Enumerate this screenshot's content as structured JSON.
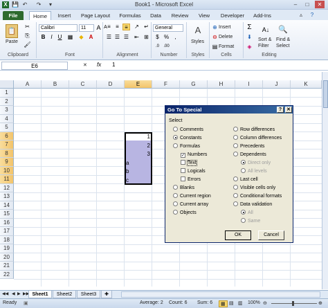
{
  "window": {
    "title": "Book1 - Microsoft Excel",
    "min": "–",
    "max": "□",
    "close": "✕"
  },
  "qat": {
    "save_icon": "💾",
    "undo_icon": "↶",
    "redo_icon": "↷"
  },
  "tabs": {
    "file": "File",
    "items": [
      "Home",
      "Insert",
      "Page Layout",
      "Formulas",
      "Data",
      "Review",
      "View",
      "Developer",
      "Add-Ins"
    ]
  },
  "ribbon": {
    "clipboard": {
      "paste": "Paste",
      "label": "Clipboard"
    },
    "font": {
      "name": "Calibri",
      "size": "11",
      "bold": "B",
      "italic": "I",
      "underline": "U",
      "label": "Font",
      "grow": "A",
      "shrink": "A"
    },
    "alignment": {
      "label": "Alignment"
    },
    "number": {
      "format": "General",
      "currency": "$",
      "percent": "%",
      "comma": ",",
      "label": "Number"
    },
    "styles": {
      "label": "Styles"
    },
    "cells": {
      "insert": "Insert",
      "delete": "Delete",
      "format": "Format",
      "label": "Cells"
    },
    "editing": {
      "sum": "Σ",
      "sort": "Sort &",
      "sort2": "Filter",
      "find": "Find &",
      "find2": "Select",
      "label": "Editing"
    }
  },
  "formula_bar": {
    "name_box": "E6",
    "fx": "fx",
    "value": "1"
  },
  "columns": [
    "A",
    "B",
    "C",
    "D",
    "E",
    "F",
    "G",
    "H",
    "I",
    "J",
    "K"
  ],
  "rows": [
    "1",
    "2",
    "3",
    "4",
    "5",
    "6",
    "7",
    "8",
    "9",
    "10",
    "11",
    "12",
    "13",
    "14",
    "15",
    "16",
    "17",
    "18",
    "19",
    "20",
    "21",
    "22"
  ],
  "cells": {
    "e6": "1",
    "e7": "2",
    "e8": "3",
    "e9": "a",
    "e10": "b",
    "e11": "c"
  },
  "dialog": {
    "title": "Go To Special",
    "help": "?",
    "close": "✕",
    "select_label": "Select",
    "left": [
      "Comments",
      "Constants",
      "Formulas",
      "Numbers",
      "Text",
      "Logicals",
      "Errors",
      "Blanks",
      "Current region",
      "Current array",
      "Objects"
    ],
    "right": [
      "Row differences",
      "Column differences",
      "Precedents",
      "Dependents",
      "Direct only",
      "All levels",
      "Last cell",
      "Visible cells only",
      "Conditional formats",
      "Data validation",
      "All",
      "Same"
    ],
    "ok": "OK",
    "cancel": "Cancel"
  },
  "sheets": [
    "Sheet1",
    "Sheet2",
    "Sheet3"
  ],
  "status": {
    "ready": "Ready",
    "average": "Average: 2",
    "count": "Count: 6",
    "sum": "Sum: 6",
    "zoom": "100%"
  }
}
